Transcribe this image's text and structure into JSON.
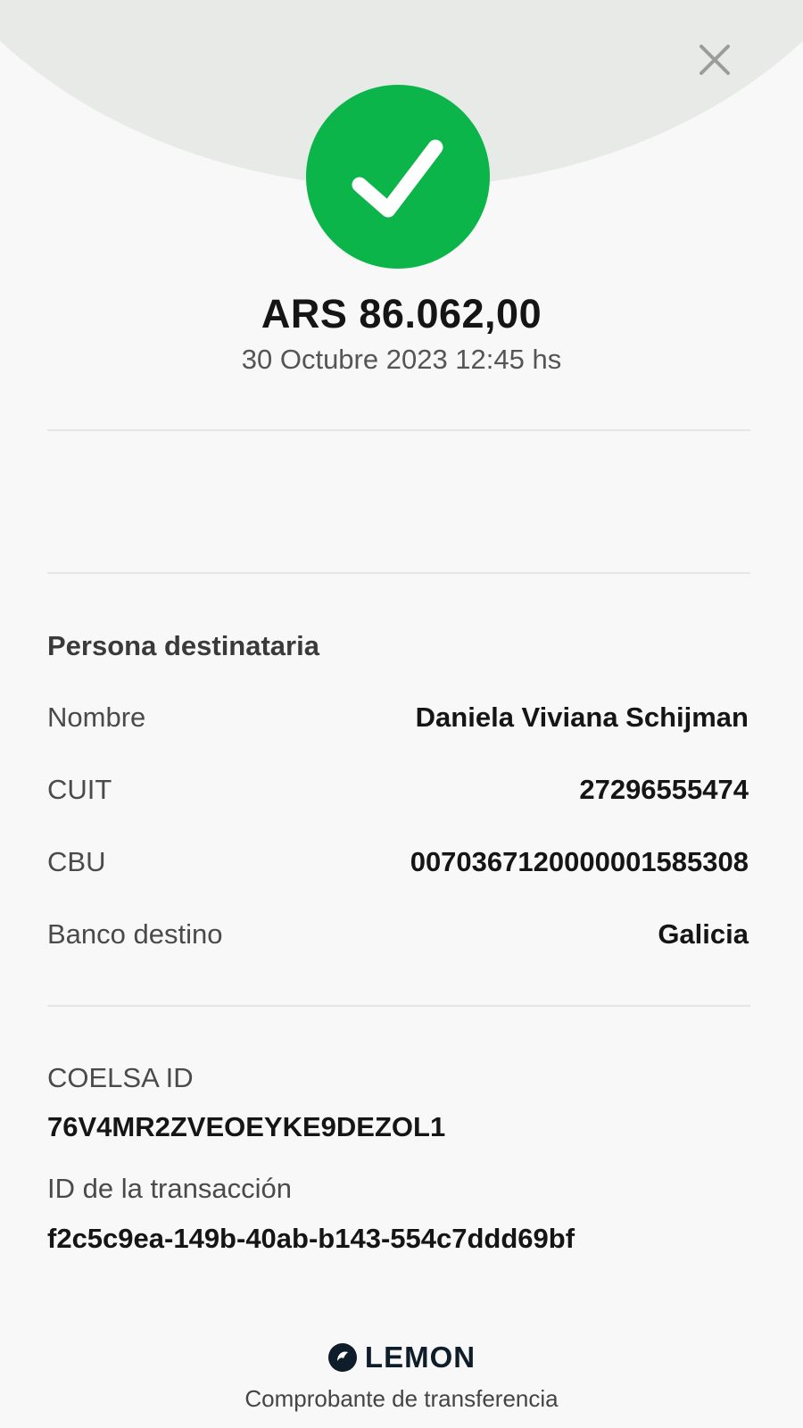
{
  "header": {
    "close_icon": "close-icon",
    "status_icon": "check-icon",
    "status_color": "#0cb54a"
  },
  "transfer": {
    "amount": "ARS 86.062,00",
    "datetime": "30 Octubre 2023 12:45 hs"
  },
  "recipient": {
    "section_title": "Persona destinataria",
    "rows": [
      {
        "label": "Nombre",
        "value": "Daniela Viviana Schijman"
      },
      {
        "label": "CUIT",
        "value": "27296555474"
      },
      {
        "label": "CBU",
        "value": "0070367120000001585308"
      },
      {
        "label": "Banco destino",
        "value": "Galicia"
      }
    ]
  },
  "ids": {
    "coelsa_label": "COELSA ID",
    "coelsa_value": "76V4MR2ZVEOEYKE9DEZOL1",
    "transaction_label": "ID de la transacción",
    "transaction_value": "f2c5c9ea-149b-40ab-b143-554c7ddd69bf"
  },
  "footer": {
    "brand": "LEMON",
    "brand_color": "#0f1d2b",
    "caption": "Comprobante de transferencia"
  }
}
